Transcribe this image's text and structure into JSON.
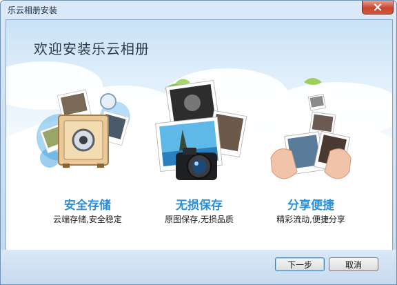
{
  "window": {
    "title": "乐云相册安装"
  },
  "heading": "欢迎安装乐云相册",
  "features": [
    {
      "title": "安全存储",
      "desc": "云端存储,安全稳定",
      "icon": "safe-icon"
    },
    {
      "title": "无损保存",
      "desc": "原图保存,无损品质",
      "icon": "camera-icon"
    },
    {
      "title": "分享便捷",
      "desc": "精彩流动,便捷分享",
      "icon": "share-photos-icon"
    }
  ],
  "buttons": {
    "next": "下一步",
    "cancel": "取消"
  },
  "colors": {
    "feature_title": "#2a8fd8",
    "close_button": "#c7462f"
  }
}
